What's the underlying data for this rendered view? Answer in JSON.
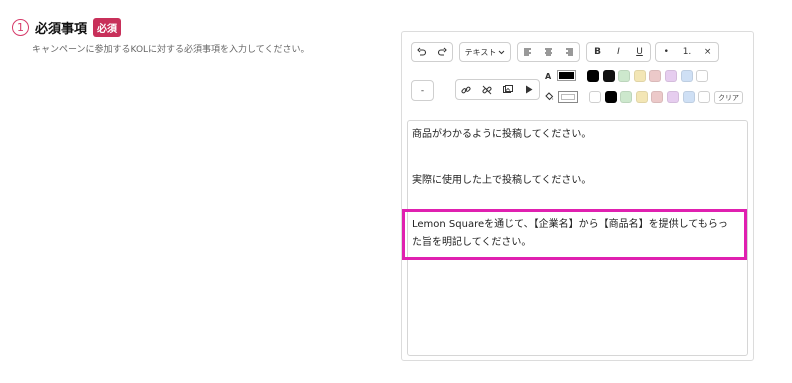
{
  "section": {
    "number": "1",
    "title": "必須事項",
    "badge": "必須",
    "description": "キャンペーンに参加するKOLに対する必須事項を入力してください。"
  },
  "toolbar": {
    "text_style_label": "テキスト",
    "bold_label": "B",
    "italic_label": "I",
    "underline_label": "U",
    "bullet_label": "•",
    "numbered_label": "1.",
    "clear_format_label": "×",
    "hr_label": "-",
    "font_color_label": "A",
    "clear_colors_label": "クリア",
    "current_font_color": "#000000",
    "current_bg_color": "#ffffff",
    "font_colors": [
      "#000000",
      "#111111",
      "#cde8cd",
      "#f3e6b5",
      "#ecc9c9",
      "#e6cdef",
      "#cfe0f5",
      "#ffffff"
    ],
    "bg_colors": [
      "#ffffff",
      "#000000",
      "#cde8cd",
      "#f3e6b5",
      "#ecc9c9",
      "#e6cdef",
      "#cfe0f5",
      "#ffffff"
    ]
  },
  "editor": {
    "paragraphs": [
      "商品がわかるように投稿してください。",
      "実際に使用した上で投稿してください。",
      "Lemon Squareを通じて、【企業名】から【商品名】を提供してもらっ",
      "た旨を明記してください。"
    ]
  },
  "accent_colors": {
    "badge": "#c8305a",
    "step": "#d63b6a",
    "highlight_border": "#e020b0"
  }
}
